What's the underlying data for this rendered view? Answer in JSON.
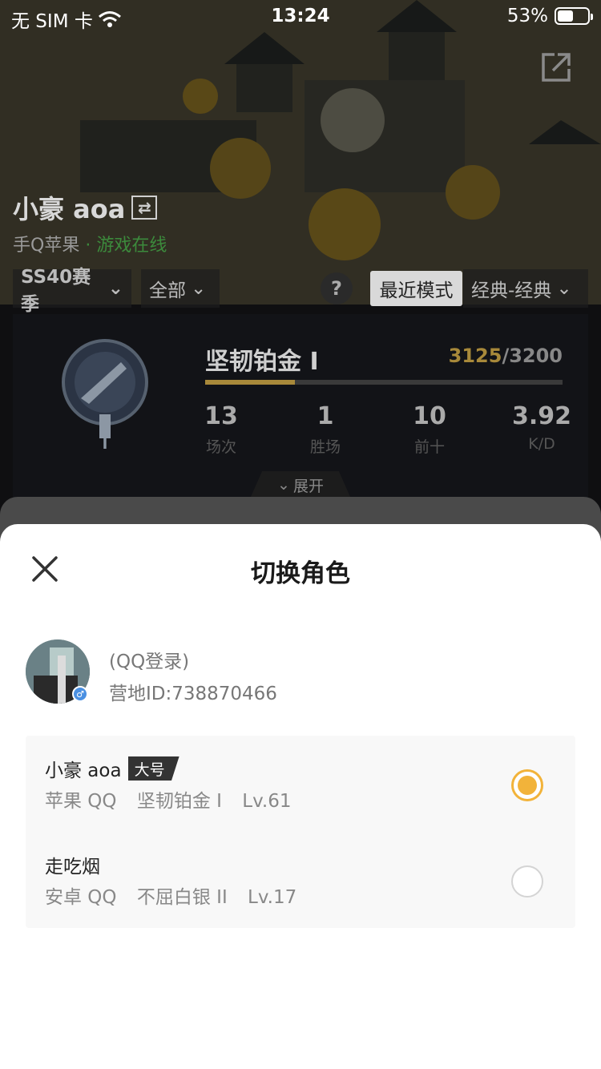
{
  "status_bar": {
    "carrier": "无 SIM 卡",
    "time": "13:24",
    "battery_percent": "53%",
    "battery_level": 0.53
  },
  "background": {
    "player_name": "小豪 aoa",
    "platform": "手Q苹果",
    "online_status": "· 游戏在线",
    "filters": {
      "season": "SS40赛季",
      "scope": "全部",
      "recent_mode": "最近模式",
      "mode": "经典-经典"
    },
    "help_label": "?",
    "rank": {
      "title": "坚韧铂金 I",
      "points_current": "3125",
      "points_total": "/3200",
      "progress": 0.25,
      "emblem_label": "I",
      "stats": [
        {
          "value": "13",
          "label": "场次"
        },
        {
          "value": "1",
          "label": "胜场"
        },
        {
          "value": "10",
          "label": "前十"
        },
        {
          "value": "3.92",
          "label": "K/D"
        }
      ],
      "expand_label": "展开"
    }
  },
  "sheet": {
    "title": "切换角色",
    "account": {
      "login_type": "(QQ登录)",
      "camp_id": "营地ID:738870466",
      "gender": "♂"
    },
    "roles": [
      {
        "name": "小豪 aoa",
        "tag": "大号",
        "platform": "苹果 QQ",
        "rank": "坚韧铂金 I",
        "level": "Lv.61",
        "selected": true
      },
      {
        "name": "走吃烟",
        "tag": "",
        "platform": "安卓 QQ",
        "rank": "不屈白银 II",
        "level": "Lv.17",
        "selected": false
      }
    ]
  },
  "colors": {
    "accent": "#f2b33a",
    "rank_gold": "#a8893a",
    "online_green": "#3c8a3c"
  }
}
